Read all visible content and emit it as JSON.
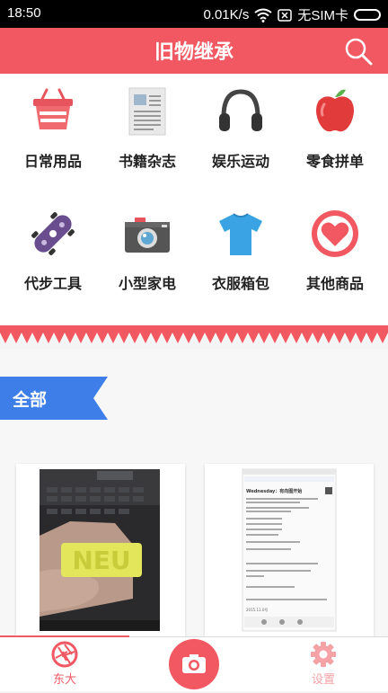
{
  "status": {
    "time": "18:50",
    "speed": "0.01K/s",
    "sim": "无SIM卡"
  },
  "header": {
    "title": "旧物继承"
  },
  "categories": [
    {
      "label": "日常用品",
      "icon": "basket-icon"
    },
    {
      "label": "书籍杂志",
      "icon": "newspaper-icon"
    },
    {
      "label": "娱乐运动",
      "icon": "headphones-icon"
    },
    {
      "label": "零食拼单",
      "icon": "apple-icon"
    },
    {
      "label": "代步工具",
      "icon": "skateboard-icon"
    },
    {
      "label": "小型家电",
      "icon": "camera-icon"
    },
    {
      "label": "衣服箱包",
      "icon": "tshirt-icon"
    },
    {
      "label": "其他商品",
      "icon": "heart-icon"
    }
  ],
  "section": {
    "label": "全部"
  },
  "cards": [
    {
      "image_text": "NEU"
    },
    {
      "doc_title": "Wednesday：有向图开始",
      "doc_date": "2015.11.0号"
    }
  ],
  "tabs": [
    {
      "label": "东大",
      "icon": "aperture-icon"
    },
    {
      "label": "",
      "icon": "camera-icon"
    },
    {
      "label": "设置",
      "icon": "gear-icon"
    }
  ],
  "colors": {
    "accent": "#f25862",
    "tag_blue": "#3d7ee8",
    "text": "#222222"
  }
}
